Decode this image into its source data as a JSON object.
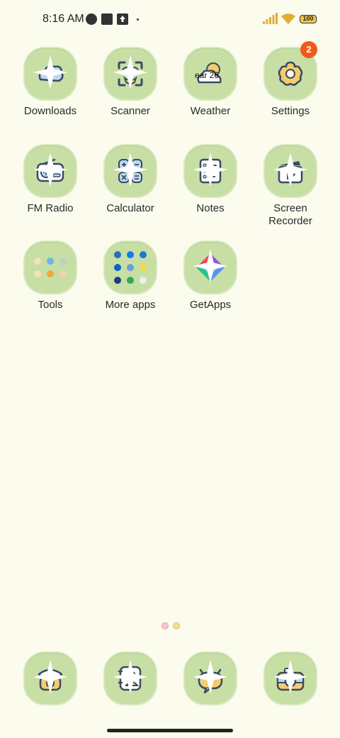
{
  "status_bar": {
    "time": "8:16 AM",
    "battery": "100",
    "icons": [
      "data-saver-icon",
      "stop-icon",
      "upload-icon",
      "dot-icon",
      "signal-icon",
      "wifi-icon",
      "battery-icon"
    ]
  },
  "apps": [
    {
      "name": "downloads",
      "label": "Downloads",
      "icon": "cloud-icon"
    },
    {
      "name": "scanner",
      "label": "Scanner",
      "icon": "scanner-icon"
    },
    {
      "name": "weather",
      "label": "Weather",
      "icon": "weather-icon",
      "overlay": "ear 26"
    },
    {
      "name": "settings",
      "label": "Settings",
      "icon": "gear-flower-icon",
      "badge": "2"
    },
    {
      "name": "fm-radio",
      "label": "FM Radio",
      "icon": "radio-icon"
    },
    {
      "name": "calculator",
      "label": "Calculator",
      "icon": "calculator-icon"
    },
    {
      "name": "notes",
      "label": "Notes",
      "icon": "notes-icon"
    },
    {
      "name": "screen-recorder",
      "label": "Screen\nRecorder",
      "icon": "clapperboard-icon"
    },
    {
      "name": "tools",
      "label": "Tools",
      "icon": "folder-icon"
    },
    {
      "name": "more-apps",
      "label": "More apps",
      "icon": "folder-icon"
    },
    {
      "name": "getapps",
      "label": "GetApps",
      "icon": "getapps-icon"
    }
  ],
  "dock": [
    {
      "name": "phone",
      "icon": "telephone-icon"
    },
    {
      "name": "contacts",
      "icon": "contacts-icon"
    },
    {
      "name": "messages",
      "icon": "chat-bubble-icon"
    },
    {
      "name": "camera",
      "icon": "camera-icon"
    }
  ],
  "colors": {
    "background": "#fbfbee",
    "icon_tile": "#c7dfa5",
    "badge": "#f15a1b",
    "battery": "#f2c94c"
  }
}
